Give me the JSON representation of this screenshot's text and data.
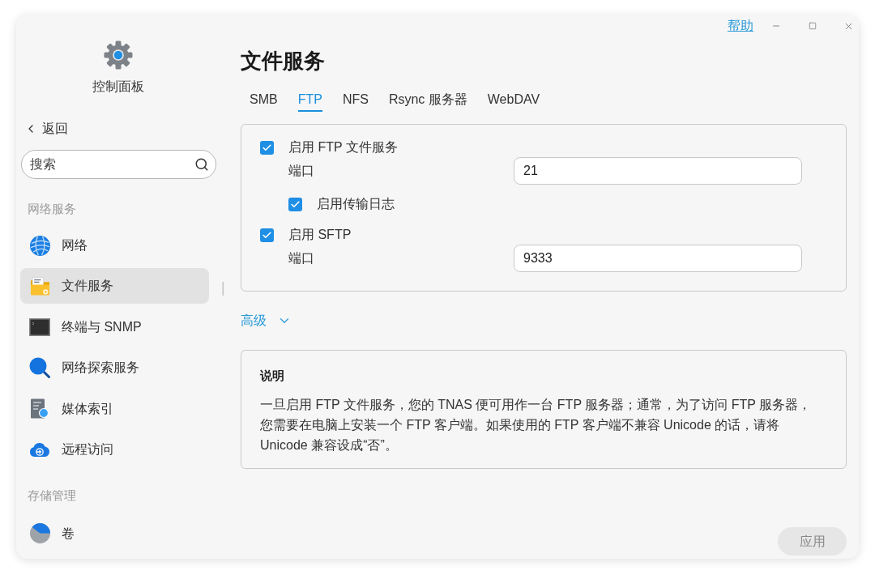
{
  "window": {
    "help_link": "帮助"
  },
  "sidebar": {
    "title": "控制面板",
    "back": "返回",
    "search": {
      "placeholder": "搜索"
    },
    "sections": [
      {
        "heading": "网络服务",
        "items": [
          {
            "label": "网络",
            "selected": false
          },
          {
            "label": "文件服务",
            "selected": true
          },
          {
            "label": "终端与 SNMP",
            "selected": false
          },
          {
            "label": "网络探索服务",
            "selected": false
          },
          {
            "label": "媒体索引",
            "selected": false
          },
          {
            "label": "远程访问",
            "selected": false
          }
        ]
      },
      {
        "heading": "存储管理",
        "items": [
          {
            "label": "卷",
            "selected": false
          }
        ]
      }
    ]
  },
  "page": {
    "title": "文件服务"
  },
  "tabs": [
    {
      "label": "SMB",
      "selected": false
    },
    {
      "label": "FTP",
      "selected": true
    },
    {
      "label": "NFS",
      "selected": false
    },
    {
      "label": "Rsync 服务器",
      "selected": false
    },
    {
      "label": "WebDAV",
      "selected": false
    }
  ],
  "ftp_settings": [
    {
      "kind": "checkbox",
      "label": "启用 FTP 文件服务",
      "checked": true,
      "children": [
        {
          "kind": "field",
          "label": "端口",
          "value": "21"
        },
        {
          "kind": "checkbox",
          "label": "启用传输日志",
          "checked": true
        }
      ]
    },
    {
      "kind": "checkbox",
      "label": "启用 SFTP",
      "checked": true,
      "children": [
        {
          "kind": "field",
          "label": "端口",
          "value": "9333"
        }
      ]
    }
  ],
  "advanced": {
    "label": "高级",
    "expanded": false
  },
  "description": {
    "title": "说明",
    "text": "一旦启用 FTP 文件服务，您的 TNAS 便可用作一台 FTP 服务器；通常，为了访问 FTP 服务器，您需要在电脑上安装一个 FTP 客户端。如果使用的 FTP 客户端不兼容 Unicode 的话，请将 Unicode 兼容设成“否”。"
  },
  "apply_button": {
    "label": "应用",
    "disabled": true
  }
}
